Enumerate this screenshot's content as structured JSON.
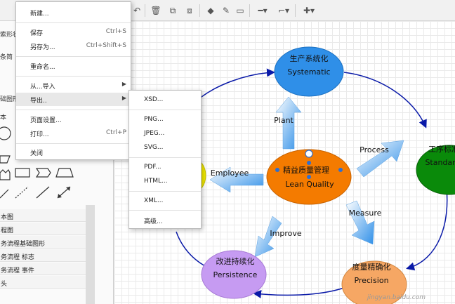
{
  "colors": {
    "blue_node": "#2f8fe8",
    "green_node": "#0a8a0a",
    "orange_node": "#f47b00",
    "purple_node": "#c69bf2",
    "peach_node": "#f6a764",
    "yellow_node": "#f2ea00",
    "cycle_line": "#0a1aa8"
  },
  "toolbar": {
    "icons": [
      "delete-icon",
      "to-front-icon",
      "to-back-icon",
      "fill-color-icon",
      "line-color-icon",
      "shadow-icon",
      "line-style-icon",
      "waypoint-icon",
      "insert-icon"
    ]
  },
  "sidebar": {
    "search_placeholder": "索形状",
    "partial_labels": [
      "条简",
      "础图形",
      "本"
    ],
    "rows": [
      "本图",
      "程图",
      "务流程基础图形",
      "务流程 标志",
      "务流程 事件",
      "头"
    ]
  },
  "file_menu": {
    "items": [
      {
        "label": "新建...",
        "shortcut": ""
      },
      {
        "label": "保存",
        "shortcut": "Ctrl+S"
      },
      {
        "label": "另存为...",
        "shortcut": "Ctrl+Shift+S"
      },
      {
        "label": "重命名...",
        "shortcut": ""
      },
      {
        "label": "从...导入",
        "shortcut": ""
      },
      {
        "label": "导出..",
        "shortcut": ""
      },
      {
        "label": "页面设置...",
        "shortcut": ""
      },
      {
        "label": "打印...",
        "shortcut": "Ctrl+P"
      },
      {
        "label": "关闭",
        "shortcut": ""
      }
    ]
  },
  "export_submenu": {
    "items": [
      "XSD...",
      "PNG...",
      "JPEG...",
      "SVG...",
      "PDF...",
      "HTML...",
      "XML...",
      "高级..."
    ]
  },
  "diagram": {
    "center": {
      "line1": "精益质量管理",
      "line2": "Lean Quality"
    },
    "top": {
      "line1": "生产系统化",
      "line2": "Systematic"
    },
    "right": {
      "line1": "工序标准",
      "line2": "Standardi"
    },
    "bottom_right": {
      "line1": "度量精确化",
      "line2": "Precision"
    },
    "bottom_left": {
      "line1": "改进持续化",
      "line2": "Persistence"
    },
    "arrows": {
      "plant": "Plant",
      "process": "Process",
      "measure": "Measure",
      "improve": "Improve",
      "employee": "Employee"
    }
  },
  "watermark": "jingyan.baidu.com"
}
